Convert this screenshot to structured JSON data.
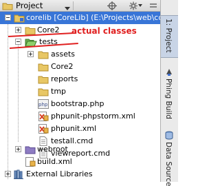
{
  "toolbar": {
    "title": "Project",
    "folder_icon": "folder-icon",
    "gear_icon": "gear-icon"
  },
  "tree": {
    "root": {
      "label": "corelib [CoreLib] (E:\\Projects\\web\\corelib"
    },
    "items": {
      "core2_top": "Core2",
      "tests": "tests",
      "assets": "assets",
      "core2_inner": "Core2",
      "reports": "reports",
      "tmp": "tmp",
      "bootstrap": "bootstrap.php",
      "phpunit_phpstorm": "phpunit-phpstorm.xml",
      "phpunit": "phpunit.xml",
      "testall": "testall.cmd",
      "viewreport": "viewreport.cmd",
      "webroot": "webroot",
      "build": "build.xml",
      "external": "External Libraries"
    }
  },
  "annotation": {
    "text": "actual classes",
    "color": "#e02020"
  },
  "sidebar": {
    "project_tab": "1: Project",
    "phing_tab": "Phing Build",
    "datasource_tab": "Data Source"
  },
  "colors": {
    "selection": "#3875d7",
    "folder": "#e8c765",
    "test_folder": "#79c15a",
    "annotation": "#e02020"
  }
}
